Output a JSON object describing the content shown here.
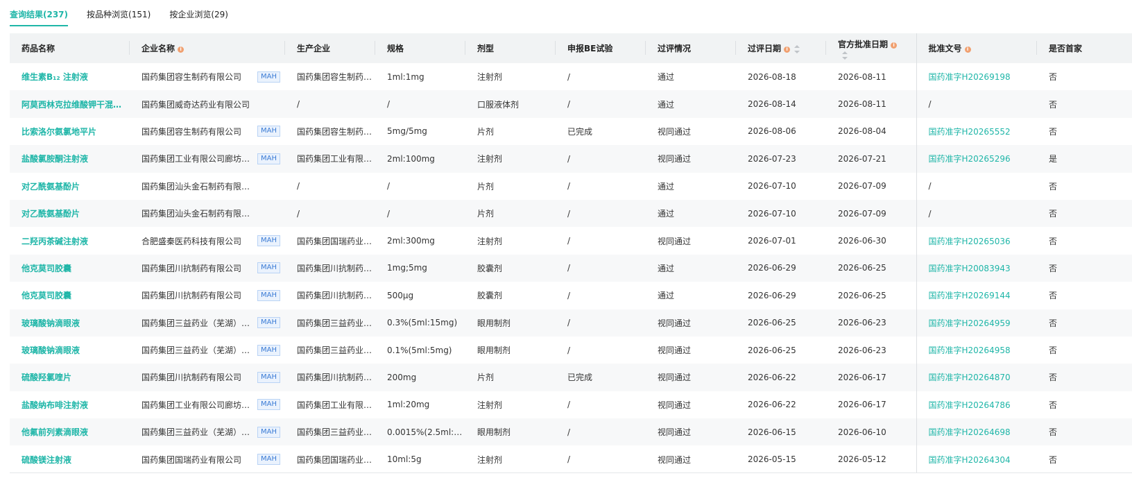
{
  "tabs": [
    {
      "label": "查询结果(237)",
      "active": true
    },
    {
      "label": "按品种浏览(151)",
      "active": false
    },
    {
      "label": "按企业浏览(29)",
      "active": false
    }
  ],
  "columns": {
    "drug": "药品名称",
    "company": "企业名称",
    "manufacturer": "生产企业",
    "spec": "规格",
    "form": "剂型",
    "be": "申报BE试验",
    "status": "过评情况",
    "review_date": "过评日期",
    "approval_date": "官方批准日期",
    "approval_no": "批准文号",
    "first": "是否首家"
  },
  "mah_label": "MAH",
  "info_glyph": "i",
  "rows": [
    {
      "drug": "维生素B₁₂ 注射液",
      "company": "国药集团容生制药有限公司",
      "mah": true,
      "manufacturer": "国药集团容生制药…",
      "spec": "1ml:1mg",
      "form": "注射剂",
      "be": "/",
      "status": "通过",
      "review_date": "2026-08-18",
      "approval_date": "2026-08-11",
      "approval_no": "国药准字H20269198",
      "first": "否"
    },
    {
      "drug": "阿莫西林克拉维酸钾干混…",
      "company": "国药集团威奇达药业有限公司",
      "mah": false,
      "manufacturer": "/",
      "spec": "/",
      "form": "口服液体剂",
      "be": "/",
      "status": "通过",
      "review_date": "2026-08-14",
      "approval_date": "2026-08-11",
      "approval_no": "/",
      "first": "否"
    },
    {
      "drug": "比索洛尔氨氯地平片",
      "company": "国药集团容生制药有限公司",
      "mah": true,
      "manufacturer": "国药集团容生制药…",
      "spec": "5mg/5mg",
      "form": "片剂",
      "be": "已完成",
      "status": "视同通过",
      "review_date": "2026-08-06",
      "approval_date": "2026-08-04",
      "approval_no": "国药准字H20265552",
      "first": "否"
    },
    {
      "drug": "盐酸氯胺酮注射液",
      "company": "国药集团工业有限公司廊坊分…",
      "mah": true,
      "manufacturer": "国药集团工业有限…",
      "spec": "2ml:100mg",
      "form": "注射剂",
      "be": "/",
      "status": "视同通过",
      "review_date": "2026-07-23",
      "approval_date": "2026-07-21",
      "approval_no": "国药准字H20265296",
      "first": "是"
    },
    {
      "drug": "对乙酰氨基酚片",
      "company": "国药集团汕头金石制药有限公司",
      "mah": false,
      "manufacturer": "/",
      "spec": "/",
      "form": "片剂",
      "be": "/",
      "status": "通过",
      "review_date": "2026-07-10",
      "approval_date": "2026-07-09",
      "approval_no": "/",
      "first": "否"
    },
    {
      "drug": "对乙酰氨基酚片",
      "company": "国药集团汕头金石制药有限公司",
      "mah": false,
      "manufacturer": "/",
      "spec": "/",
      "form": "片剂",
      "be": "/",
      "status": "通过",
      "review_date": "2026-07-10",
      "approval_date": "2026-07-09",
      "approval_no": "/",
      "first": "否"
    },
    {
      "drug": "二羟丙茶碱注射液",
      "company": "合肥盛秦医药科技有限公司",
      "mah": true,
      "manufacturer": "国药集团国瑞药业…",
      "spec": "2ml:300mg",
      "form": "注射剂",
      "be": "/",
      "status": "视同通过",
      "review_date": "2026-07-01",
      "approval_date": "2026-06-30",
      "approval_no": "国药准字H20265036",
      "first": "否"
    },
    {
      "drug": "他克莫司胶囊",
      "company": "国药集团川抗制药有限公司",
      "mah": true,
      "manufacturer": "国药集团川抗制药…",
      "spec": "1mg;5mg",
      "form": "胶囊剂",
      "be": "/",
      "status": "通过",
      "review_date": "2026-06-29",
      "approval_date": "2026-06-25",
      "approval_no": "国药准字H20083943",
      "first": "否"
    },
    {
      "drug": "他克莫司胶囊",
      "company": "国药集团川抗制药有限公司",
      "mah": true,
      "manufacturer": "国药集团川抗制药…",
      "spec": "500μg",
      "form": "胶囊剂",
      "be": "/",
      "status": "通过",
      "review_date": "2026-06-29",
      "approval_date": "2026-06-25",
      "approval_no": "国药准字H20269144",
      "first": "否"
    },
    {
      "drug": "玻璃酸钠滴眼液",
      "company": "国药集团三益药业（芜湖）有…",
      "mah": true,
      "manufacturer": "国药集团三益药业…",
      "spec": "0.3%(5ml:15mg)",
      "form": "眼用制剂",
      "be": "/",
      "status": "视同通过",
      "review_date": "2026-06-25",
      "approval_date": "2026-06-23",
      "approval_no": "国药准字H20264959",
      "first": "否"
    },
    {
      "drug": "玻璃酸钠滴眼液",
      "company": "国药集团三益药业（芜湖）有…",
      "mah": true,
      "manufacturer": "国药集团三益药业…",
      "spec": "0.1%(5ml:5mg)",
      "form": "眼用制剂",
      "be": "/",
      "status": "视同通过",
      "review_date": "2026-06-25",
      "approval_date": "2026-06-23",
      "approval_no": "国药准字H20264958",
      "first": "否"
    },
    {
      "drug": "硫酸羟氯喹片",
      "company": "国药集团川抗制药有限公司",
      "mah": true,
      "manufacturer": "国药集团川抗制药…",
      "spec": "200mg",
      "form": "片剂",
      "be": "已完成",
      "status": "视同通过",
      "review_date": "2026-06-22",
      "approval_date": "2026-06-17",
      "approval_no": "国药准字H20264870",
      "first": "否"
    },
    {
      "drug": "盐酸纳布啡注射液",
      "company": "国药集团工业有限公司廊坊分…",
      "mah": true,
      "manufacturer": "国药集团工业有限…",
      "spec": "1ml:20mg",
      "form": "注射剂",
      "be": "/",
      "status": "视同通过",
      "review_date": "2026-06-22",
      "approval_date": "2026-06-17",
      "approval_no": "国药准字H20264786",
      "first": "否"
    },
    {
      "drug": "他氟前列素滴眼液",
      "company": "国药集团三益药业（芜湖）有…",
      "mah": true,
      "manufacturer": "国药集团三益药业…",
      "spec": "0.0015%(2.5ml:3…",
      "form": "眼用制剂",
      "be": "/",
      "status": "视同通过",
      "review_date": "2026-06-15",
      "approval_date": "2026-06-10",
      "approval_no": "国药准字H20264698",
      "first": "否"
    },
    {
      "drug": "硫酸镁注射液",
      "company": "国药集团国瑞药业有限公司",
      "mah": true,
      "manufacturer": "国药集团国瑞药业…",
      "spec": "10ml:5g",
      "form": "注射剂",
      "be": "/",
      "status": "视同通过",
      "review_date": "2026-05-15",
      "approval_date": "2026-05-12",
      "approval_no": "国药准字H20264304",
      "first": "否"
    }
  ]
}
